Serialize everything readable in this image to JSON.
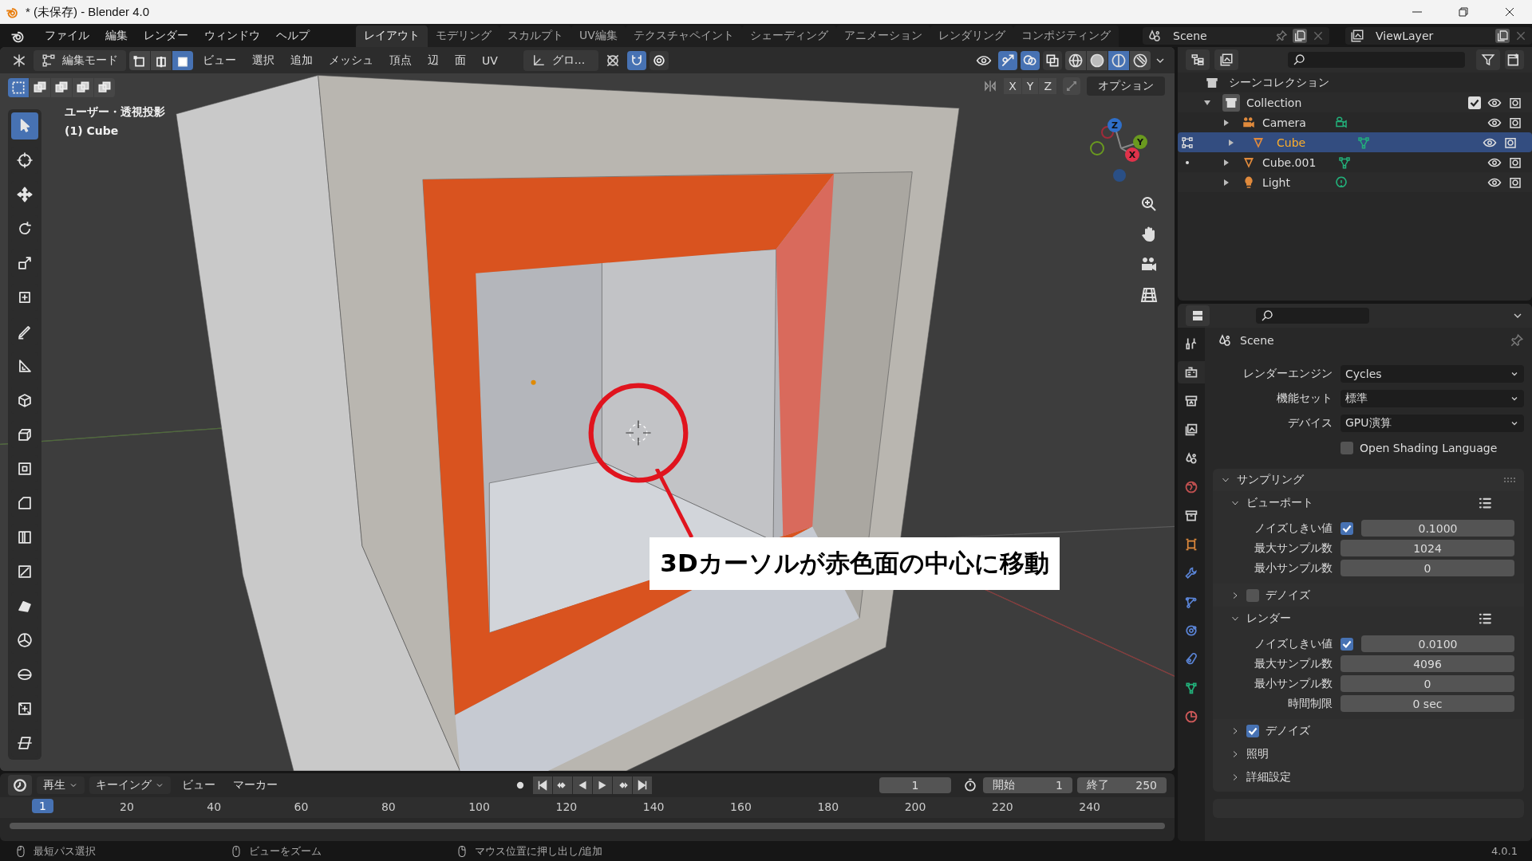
{
  "window": {
    "title": "* (未保存) - Blender 4.0"
  },
  "menu": [
    "ファイル",
    "編集",
    "レンダー",
    "ウィンドウ",
    "ヘルプ"
  ],
  "workspaces": [
    {
      "label": "レイアウト",
      "selected": true
    },
    {
      "label": "モデリング",
      "selected": false
    },
    {
      "label": "スカルプト",
      "selected": false
    },
    {
      "label": "UV編集",
      "selected": false
    },
    {
      "label": "テクスチャペイント",
      "selected": false
    },
    {
      "label": "シェーディング",
      "selected": false
    },
    {
      "label": "アニメーション",
      "selected": false
    },
    {
      "label": "レンダリング",
      "selected": false
    },
    {
      "label": "コンポジティング",
      "selected": false
    }
  ],
  "scene": "Scene",
  "view_layer": "ViewLayer",
  "viewport_header": {
    "mode": "編集モード",
    "select_modes": [
      {
        "kind": "vertex",
        "selected": false
      },
      {
        "kind": "edge",
        "selected": false
      },
      {
        "kind": "face",
        "selected": true
      }
    ],
    "menus": [
      "ビュー",
      "選択",
      "追加",
      "メッシュ",
      "頂点",
      "辺",
      "面",
      "UV"
    ],
    "orientation": "グロ...",
    "toggles": [
      {
        "kind": "snap",
        "on": true
      },
      {
        "kind": "proportional",
        "on": false
      }
    ],
    "overlay_toggles": [
      {
        "kind": "gizmo",
        "on": true
      },
      {
        "kind": "overlays",
        "on": true
      },
      {
        "kind": "xray",
        "on": false
      }
    ],
    "shading": [
      {
        "kind": "wireframe",
        "selected": false
      },
      {
        "kind": "solid",
        "selected": false
      },
      {
        "kind": "material",
        "selected": true
      },
      {
        "kind": "rendered",
        "selected": false
      }
    ]
  },
  "viewport": {
    "select_box_modes": [
      {
        "selected": true
      },
      {
        "selected": false
      },
      {
        "selected": false
      },
      {
        "selected": false
      },
      {
        "selected": false
      }
    ],
    "axes": [
      "X",
      "Y",
      "Z"
    ],
    "options": "オプション",
    "view_name": "ユーザー・透視投影",
    "object": "(1) Cube",
    "caption": "3Dカーソルが赤色面の中心に移動",
    "gizmo": [
      {
        "label": "Z",
        "color": "#2f6fc9"
      },
      {
        "label": "Y",
        "color": "#6a9a1f"
      },
      {
        "label": "X",
        "color": "#e0324a"
      }
    ],
    "tools": [
      {
        "kind": "select",
        "selected": true
      },
      {
        "kind": "cursor",
        "selected": false
      },
      {
        "kind": "move",
        "selected": false
      },
      {
        "kind": "rotate",
        "selected": false
      },
      {
        "kind": "scale",
        "selected": false
      },
      {
        "kind": "transform",
        "selected": false
      },
      {
        "kind": "annotate",
        "selected": false
      },
      {
        "kind": "measure",
        "selected": false
      },
      {
        "kind": "addcube",
        "selected": false
      },
      {
        "kind": "extrude",
        "selected": false
      },
      {
        "kind": "inset",
        "selected": false
      },
      {
        "kind": "bevel",
        "selected": false
      },
      {
        "kind": "loopcut",
        "selected": false
      },
      {
        "kind": "knife",
        "selected": false
      },
      {
        "kind": "polybuild",
        "selected": false
      },
      {
        "kind": "spin",
        "selected": false
      },
      {
        "kind": "smooth",
        "selected": false
      },
      {
        "kind": "shrink",
        "selected": false
      },
      {
        "kind": "shear",
        "selected": false
      }
    ]
  },
  "outliner": {
    "root": "シーンコレクション",
    "collections": [
      {
        "label": "Collection",
        "expanded": true,
        "checked": true,
        "children": [
          {
            "label": "Camera",
            "kind": "camera",
            "selected": false
          },
          {
            "label": "Cube",
            "kind": "mesh",
            "selected": true,
            "edit_mode": true
          },
          {
            "label": "Cube.001",
            "kind": "mesh",
            "selected": false,
            "edit_mode": false
          },
          {
            "label": "Light",
            "kind": "light",
            "selected": false
          }
        ]
      }
    ]
  },
  "properties": {
    "tabs": [
      {
        "kind": "tool",
        "selected": false
      },
      {
        "kind": "render",
        "selected": true
      },
      {
        "kind": "output",
        "selected": false
      },
      {
        "kind": "viewlayer",
        "selected": false
      },
      {
        "kind": "scene",
        "selected": false
      },
      {
        "kind": "world",
        "selected": false
      },
      {
        "kind": "collection",
        "selected": false
      },
      {
        "kind": "object",
        "selected": false
      },
      {
        "kind": "modifier",
        "selected": false
      },
      {
        "kind": "particles",
        "selected": false
      },
      {
        "kind": "physics",
        "selected": false
      },
      {
        "kind": "constraints",
        "selected": false
      },
      {
        "kind": "data",
        "selected": false
      },
      {
        "kind": "material",
        "selected": false
      }
    ],
    "title": "Scene",
    "fields": [
      {
        "label": "レンダーエンジン",
        "value": "Cycles"
      },
      {
        "label": "機能セット",
        "value": "標準"
      },
      {
        "label": "デバイス",
        "value": "GPU演算"
      }
    ],
    "osl": {
      "label": "Open Shading Language",
      "checked": false
    },
    "panel": {
      "label": "サンプリング",
      "expanded": true,
      "subsections": [
        {
          "label": "ビューポート",
          "expanded": true,
          "rows": [
            {
              "label": "ノイズしきい値",
              "checked": true,
              "value": "0.1000"
            },
            {
              "label": "最大サンプル数",
              "value": "1024"
            },
            {
              "label": "最小サンプル数",
              "value": "0"
            }
          ]
        },
        {
          "label": "デノイズ",
          "expanded": false,
          "checked": false
        },
        {
          "label": "レンダー",
          "expanded": true,
          "rows": [
            {
              "label": "ノイズしきい値",
              "checked": true,
              "value": "0.0100"
            },
            {
              "label": "最大サンプル数",
              "value": "4096"
            },
            {
              "label": "最小サンプル数",
              "value": "0"
            },
            {
              "label": "時間制限",
              "value": "0 sec"
            }
          ]
        },
        {
          "label": "デノイズ",
          "expanded": false,
          "checked": true
        },
        {
          "label": "照明",
          "expanded": false
        },
        {
          "label": "詳細設定",
          "expanded": false
        }
      ]
    }
  },
  "timeline": {
    "menus": [
      {
        "label": "再生",
        "dropdown": true
      },
      {
        "label": "キーイング",
        "dropdown": true
      },
      {
        "label": "ビュー",
        "dropdown": false
      },
      {
        "label": "マーカー",
        "dropdown": false
      }
    ],
    "current_frame": "1",
    "start_label": "開始",
    "start": "1",
    "end_label": "終了",
    "end": "250",
    "playhead": "1",
    "ticks": [
      "20",
      "40",
      "60",
      "80",
      "100",
      "120",
      "140",
      "160",
      "180",
      "200",
      "220",
      "240"
    ]
  },
  "status_bar": {
    "hints": [
      "最短パス選択",
      "ビューをズーム",
      "マウス位置に押し出し/追加"
    ],
    "version": "4.0.1"
  }
}
